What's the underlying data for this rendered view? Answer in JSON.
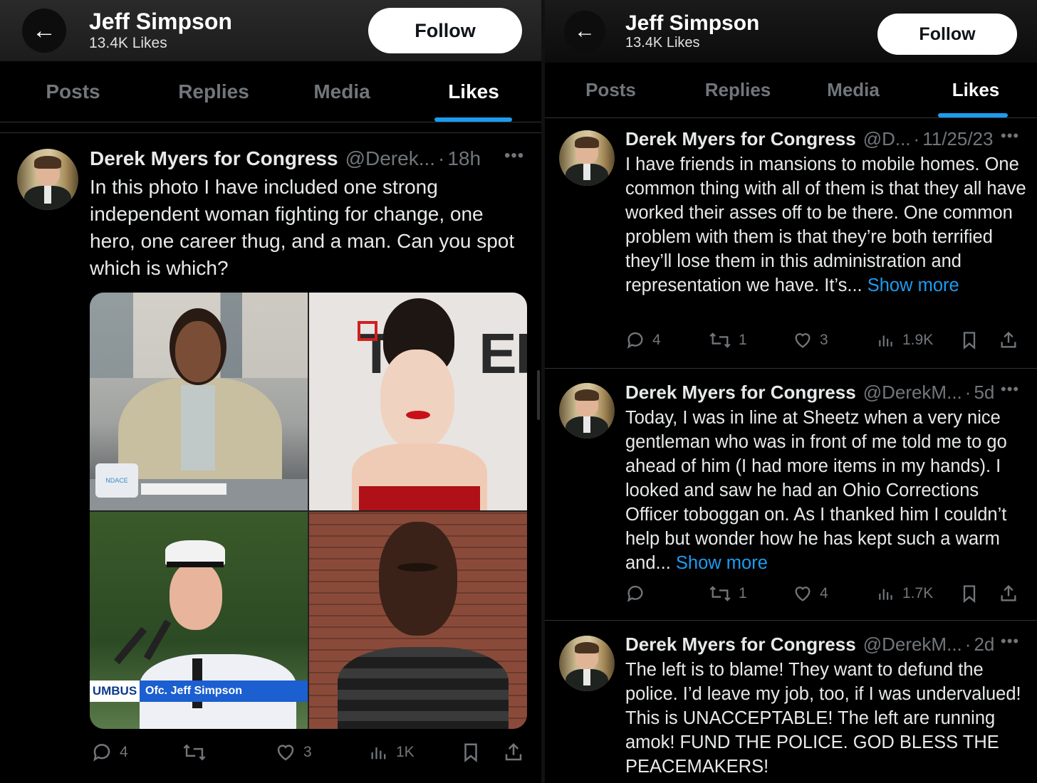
{
  "left": {
    "header": {
      "name": "Jeff Simpson",
      "likes": "13.4K Likes",
      "follow": "Follow"
    },
    "tabs": [
      "Posts",
      "Replies",
      "Media",
      "Likes"
    ],
    "tweet": {
      "author": "Derek Myers for Congress",
      "handle": "@Derek...",
      "time": "18h",
      "text": "In this photo I have included one strong independent woman fighting for change, one hero, one career thug, and a man. Can you spot which is which?",
      "photo_sign": "T      ER",
      "caption_city": "UMBUS",
      "caption_name": "Ofc. Jeff Simpson",
      "mug_label": "NDACE",
      "replies": "4",
      "retweets": "",
      "likes": "3",
      "views": "1K"
    }
  },
  "right": {
    "header": {
      "name": "Jeff Simpson",
      "likes": "13.4K Likes",
      "follow": "Follow"
    },
    "tabs": [
      "Posts",
      "Replies",
      "Media",
      "Likes"
    ],
    "tweets": [
      {
        "author": "Derek Myers for Congress",
        "handle": "@D...",
        "time": "11/25/23",
        "text": "I have friends in mansions to mobile homes. One common thing with all of them is that they all have worked their asses off to be there. One common problem with them is that they’re both terrified they’ll lose them in this administration and representation we have. It’s...",
        "show_more": "Show more",
        "replies": "4",
        "retweets": "1",
        "likes": "3",
        "views": "1.9K"
      },
      {
        "author": "Derek Myers for Congress",
        "handle": "@DerekM...",
        "time": "5d",
        "text": "Today, I was in line at Sheetz when a very nice gentleman who was in front of me told me to go ahead of him (I had more items in my hands). I looked and saw he had an Ohio Corrections Officer toboggan on. As I thanked him I couldn’t help but wonder how he has kept such a warm and...",
        "show_more": "Show more",
        "replies": "",
        "retweets": "1",
        "likes": "4",
        "views": "1.7K"
      },
      {
        "author": "Derek Myers for Congress",
        "handle": "@DerekM...",
        "time": "2d",
        "text": "The left is to blame! They want to defund the police. I’d leave my job, too, if I was undervalued! This is UNACCEPTABLE! The left are running amok! FUND THE POLICE. GOD BLESS THE PEACEMAKERS!"
      }
    ]
  },
  "colors": {
    "accent": "#1d9bf0",
    "muted": "#71767b",
    "text": "#e7e9ea",
    "background": "#000000"
  }
}
